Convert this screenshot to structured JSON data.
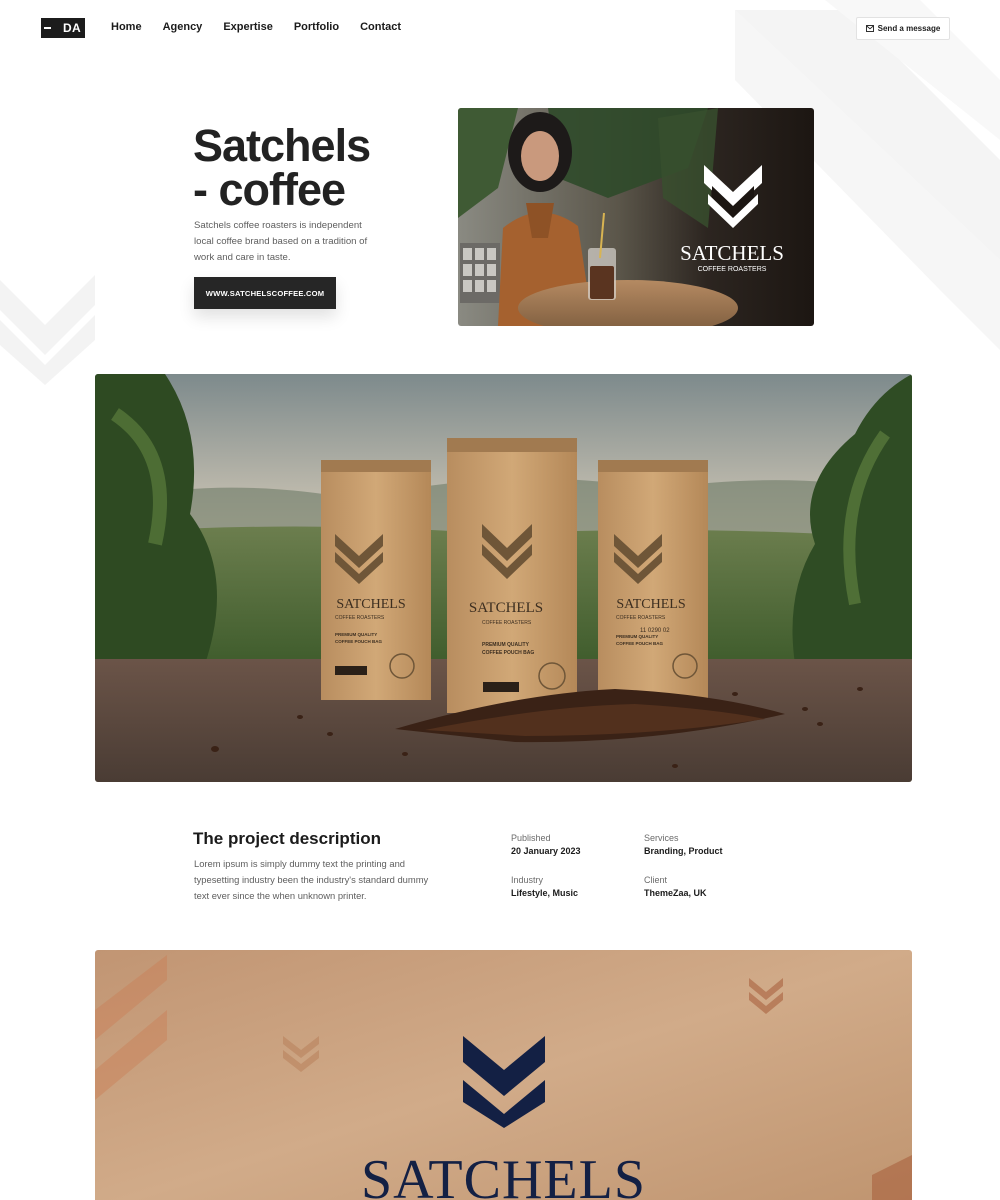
{
  "header": {
    "logo_text": "DA",
    "nav": [
      "Home",
      "Agency",
      "Expertise",
      "Portfolio",
      "Contact"
    ],
    "send_label": "Send a message"
  },
  "hero": {
    "title_line1": "Satchels",
    "title_line2": "- coffee",
    "description": "Satchels coffee roasters is independent local coffee brand based on a tradition of work and care in taste.",
    "cta_label": "WWW.SATCHELSCOFFEE.COM",
    "photo_brand": "SATCHELS",
    "photo_sub": "COFFEE ROASTERS"
  },
  "product_photo": {
    "bag_brand": "SATCHELS",
    "bag_sub": "COFFEE ROASTERS",
    "bag_quality": "PREMIUM QUALITY",
    "bag_type": "COFFEE POUCH BAG",
    "bag_code": "11 0290 02"
  },
  "project": {
    "title": "The project description",
    "text": "Lorem ipsum is simply dummy text the printing and typesetting industry been the industry's standard dummy text ever since the when unknown printer.",
    "meta": [
      {
        "label": "Published",
        "value": "20 January 2023"
      },
      {
        "label": "Services",
        "value": "Branding, Product"
      },
      {
        "label": "Industry",
        "value": "Lifestyle, Music"
      },
      {
        "label": "Client",
        "value": "ThemeZaa, UK"
      }
    ]
  },
  "brand_panel": {
    "word": "SATCHELS"
  },
  "colors": {
    "dark": "#262626",
    "kraft": "#c9a07d",
    "navy": "#132044"
  }
}
